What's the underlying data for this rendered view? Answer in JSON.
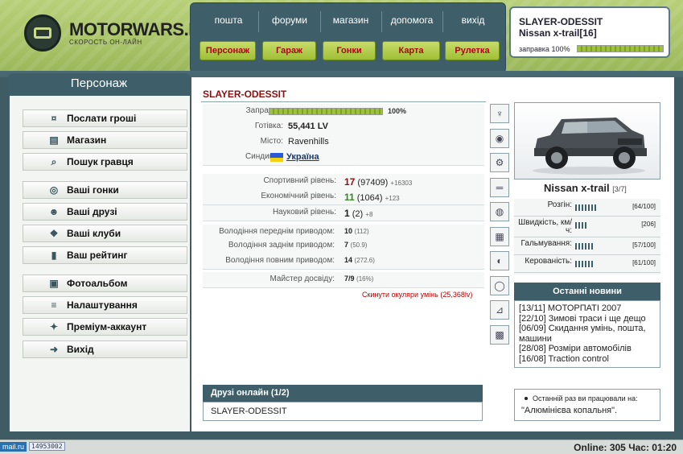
{
  "site": {
    "logo_title": "MOTORWARS.RU",
    "logo_sub": "СКОРОСТЬ ОН-ЛАЙН"
  },
  "topnav": {
    "links": [
      "пошта",
      "форуми",
      "магазин",
      "допомога",
      "вихід"
    ],
    "buttons": [
      "Персонаж",
      "Гараж",
      "Гонки",
      "Карта",
      "Рулетка"
    ]
  },
  "userbox": {
    "name": "SLAYER-ODESSIT",
    "car": "Nissan x-trail[16]",
    "fuel_label": "заправка 100%",
    "fuel_fraction": 1.0
  },
  "sidebar": {
    "title": "Персонаж",
    "items": [
      "Послати гроші",
      "Магазин",
      "Пошук гравця",
      "Ваші гонки",
      "Ваші друзі",
      "Ваші клуби",
      "Ваш рейтинг",
      "Фотоальбом",
      "Налаштування",
      "Преміум-аккаунт",
      "Вихід"
    ],
    "icons": [
      "money-icon",
      "shop-icon",
      "search-icon",
      "steering-wheel-icon",
      "friends-icon",
      "clubs-icon",
      "rating-icon",
      "photo-icon",
      "settings-icon",
      "premium-icon",
      "exit-icon"
    ]
  },
  "character": {
    "name": "SLAYER-ODESSIT",
    "fuel": {
      "label": "Заправка:",
      "pct": "100%",
      "fraction": 1.0
    },
    "cash": {
      "label": "Готівка:",
      "value": "55,441 LV"
    },
    "city": {
      "label": "Місто:",
      "value": "Ravenhills"
    },
    "syndicate": {
      "label": "Синдикат:",
      "value": "Україна"
    },
    "levels": [
      {
        "label": "Спортивний рівень:",
        "level": "17",
        "points": "(97409)",
        "delta": "+16303",
        "color": "#8a0f0f"
      },
      {
        "label": "Економічний рівень:",
        "level": "11",
        "points": "(1064)",
        "delta": "+123",
        "color": "#2e8a1f"
      },
      {
        "label": "Науковий рівень:",
        "level": "1",
        "points": "(2)",
        "delta": "+8",
        "color": "#222222"
      }
    ],
    "skills": [
      {
        "label": "Володіння переднім приводом:",
        "value": "10",
        "detail": "(112)"
      },
      {
        "label": "Володіння заднім приводом:",
        "value": "7",
        "detail": "(50.9)"
      },
      {
        "label": "Володіння повним приводом:",
        "value": "14",
        "detail": "(272.6)"
      }
    ],
    "mastery": {
      "label": "Майстер досвіду:",
      "value": "7/9",
      "detail": "(16%)"
    },
    "reset_link": "Скинути окуляри умінь (25,368lv)"
  },
  "tools": [
    "suspension-icon",
    "tire-icon",
    "gearbox-icon",
    "exhaust-icon",
    "turbo-icon",
    "engine-icon",
    "brake-icon",
    "wheel-icon",
    "seat-icon",
    "chip-icon"
  ],
  "car": {
    "name": "Nissan x-trail",
    "slots": "[3/7]",
    "specs": [
      {
        "label": "Розгін:",
        "value": "[64/100]",
        "level": 0.64
      },
      {
        "label": "Швидкість, км/ч:",
        "value": "[206]",
        "level": 0.35
      },
      {
        "label": "Гальмування:",
        "value": "[57/100]",
        "level": 0.57
      },
      {
        "label": "Керованість:",
        "value": "[61/100]",
        "level": 0.61
      }
    ]
  },
  "news": {
    "title": "Останні новини",
    "items": [
      "[13/11] МОТОРПАТІ 2007",
      "[22/10] Зимові траси і ще дещо",
      "[06/09] Скидання умінь, пошта, машини",
      "[28/08] Розміри автомобілів",
      "[16/08] Traction control"
    ]
  },
  "last_work": {
    "text": "Останній раз ви працювали на:",
    "value": "\"Алюмінієва копальня\"."
  },
  "friends": {
    "title": "Друзі онлайн (1/2)",
    "items": [
      "SLAYER-ODESSIT"
    ]
  },
  "statusbar": {
    "mailru": "mail.ru",
    "counter": "14953002",
    "online": "Online: 305  Час: 01:20"
  },
  "colors": {
    "header_green": "#a7c266",
    "panel": "#3e5f6a",
    "accent_red": "#b2001a"
  }
}
